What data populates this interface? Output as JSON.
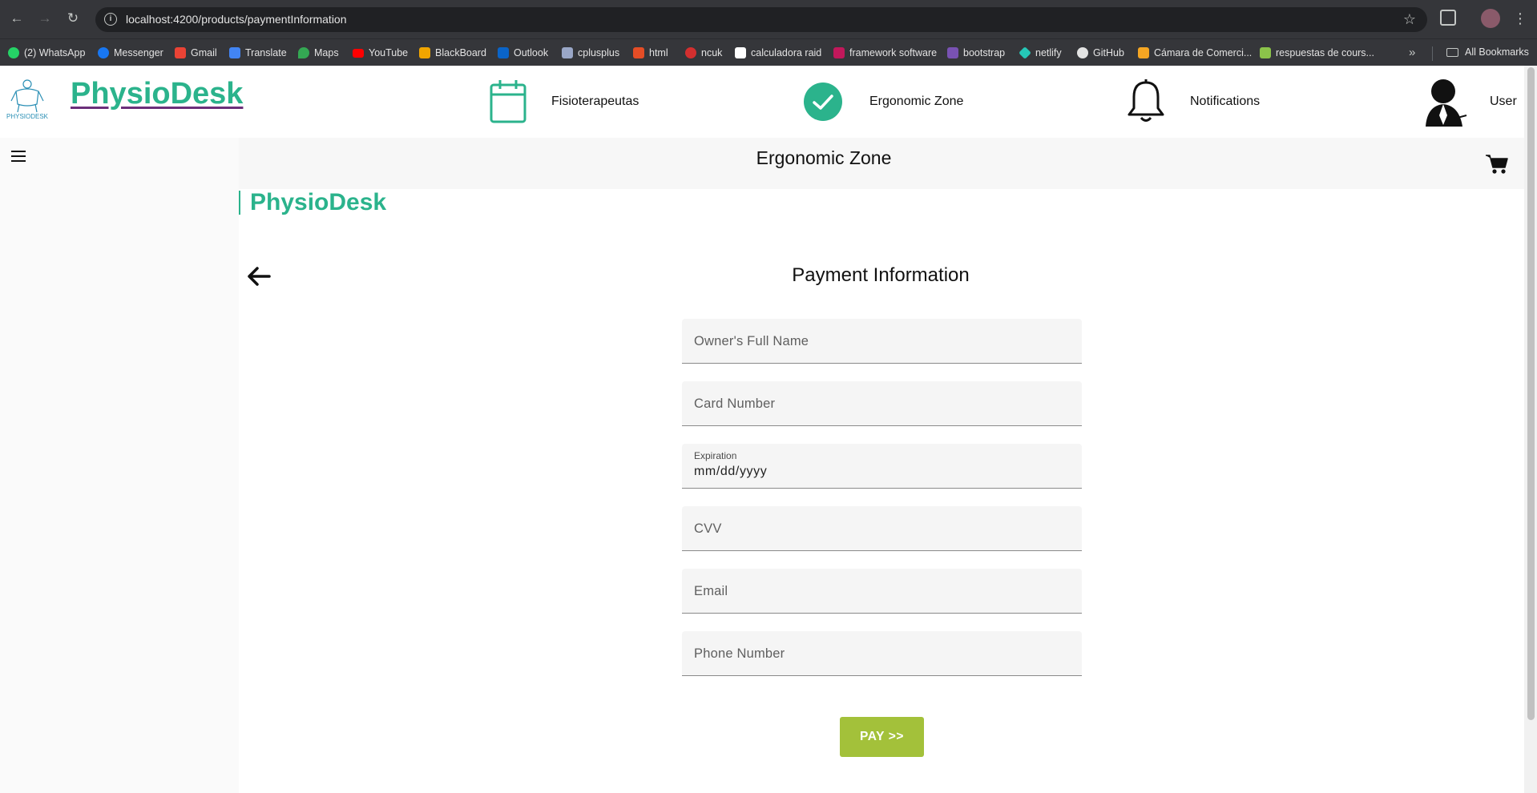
{
  "browser": {
    "url_host": "localhost",
    "url_rest": ":4200/products/paymentInformation",
    "nav": {
      "back": "←",
      "forward": "→",
      "reload": "↻"
    },
    "bookmarks": [
      {
        "label": "(2) WhatsApp",
        "color": "#25d366"
      },
      {
        "label": "Messenger",
        "color": "#1877f2"
      },
      {
        "label": "Gmail",
        "color": "#ea4335"
      },
      {
        "label": "Translate",
        "color": "#4285f4"
      },
      {
        "label": "Maps",
        "color": "#34a853"
      },
      {
        "label": "YouTube",
        "color": "#ff0000"
      },
      {
        "label": "BlackBoard",
        "color": "#f0a500"
      },
      {
        "label": "Outlook",
        "color": "#0a64c8"
      },
      {
        "label": "cplusplus",
        "color": "#9aa7c7"
      },
      {
        "label": "html",
        "color": "#e44d26"
      },
      {
        "label": "ncuk",
        "color": "#d32f2f"
      },
      {
        "label": "calculadora raid",
        "color": "#ffffff"
      },
      {
        "label": "framework software",
        "color": "#c2185b"
      },
      {
        "label": "bootstrap",
        "color": "#7952b3"
      },
      {
        "label": "netlify",
        "color": "#25c7b7"
      },
      {
        "label": "GitHub",
        "color": "#e3e3e3"
      },
      {
        "label": "Cámara de Comerci...",
        "color": "#f5a623"
      },
      {
        "label": "respuestas de cours...",
        "color": "#8bc34a"
      }
    ],
    "more": "»",
    "all_bookmarks": "All Bookmarks"
  },
  "header": {
    "brand": "PhysioDesk",
    "logo_text": "PHYSIODESK",
    "nav": [
      {
        "label": "Fisioterapeutas",
        "icon": "calendar-icon"
      },
      {
        "label": "Ergonomic Zone",
        "icon": "check-circle-icon"
      },
      {
        "label": "Notifications",
        "icon": "bell-icon"
      },
      {
        "label": "User",
        "icon": "user-avatar-icon"
      }
    ]
  },
  "toolbar": {
    "title": "Ergonomic Zone"
  },
  "sub_brand": "PhysioDesk",
  "page": {
    "title": "Payment Information",
    "fields": {
      "owner_name": {
        "placeholder": "Owner's Full Name"
      },
      "card_number": {
        "placeholder": "Card Number"
      },
      "expiration": {
        "label": "Expiration",
        "value": "mm/dd/yyyy"
      },
      "cvv": {
        "placeholder": "CVV"
      },
      "email": {
        "placeholder": "Email"
      },
      "phone": {
        "placeholder": "Phone Number"
      }
    },
    "pay_button": "PAY >>"
  },
  "colors": {
    "brand_green": "#2bb38c",
    "pay_green": "#a3c13a",
    "brand_underline": "#6b2f7a"
  }
}
